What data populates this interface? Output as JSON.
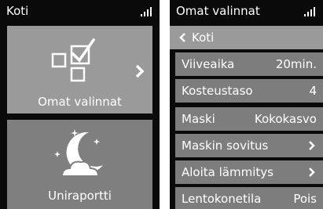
{
  "left_screen": {
    "title": "Koti",
    "tiles": [
      {
        "label": "Omat valinnat",
        "icon": "checklist-icon"
      },
      {
        "label": "Uniraportti",
        "icon": "moon-clouds-stars-icon"
      }
    ]
  },
  "right_screen": {
    "title": "Omat valinnat",
    "back_label": "Koti",
    "rows": [
      {
        "label": "Viiveaika",
        "value": "20min."
      },
      {
        "label": "Kosteustaso",
        "value": "4"
      },
      {
        "label": "Maski",
        "value": "Kokokasvo"
      },
      {
        "label": "Maskin sovitus",
        "value": ""
      },
      {
        "label": "Aloita lämmitys",
        "value": ""
      },
      {
        "label": "Lentokonetila",
        "value": "Pois"
      }
    ]
  }
}
